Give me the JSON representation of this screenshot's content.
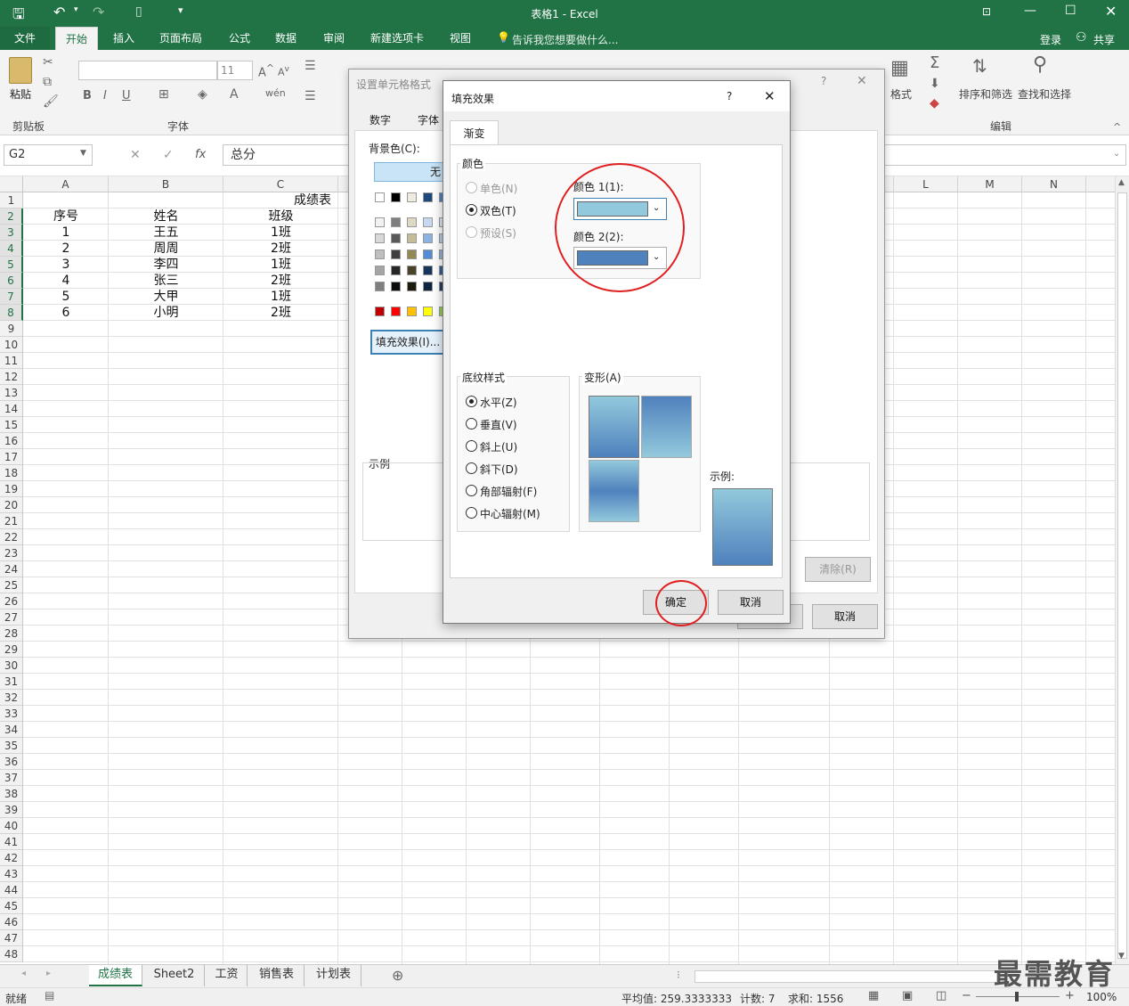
{
  "title_bar": {
    "doc_title": "表格1 - Excel"
  },
  "ribbon_tabs": [
    {
      "label": "文件"
    },
    {
      "label": "开始"
    },
    {
      "label": "插入"
    },
    {
      "label": "页面布局"
    },
    {
      "label": "公式"
    },
    {
      "label": "数据"
    },
    {
      "label": "审阅"
    },
    {
      "label": "新建选项卡"
    },
    {
      "label": "视图"
    }
  ],
  "tell_me": "告诉我您想要做什么...",
  "login": "登录",
  "share": "共享",
  "ribbon": {
    "paste": "粘贴",
    "clipboard_group": "剪贴板",
    "font_group": "字体",
    "font_size": "11",
    "format_label": "格式",
    "sort_filter": "排序和筛选",
    "find_select": "查找和选择",
    "edit_group": "编辑"
  },
  "formula_bar": {
    "cell_ref": "G2",
    "formula": "总分"
  },
  "columns": [
    "A",
    "B",
    "C",
    "L",
    "M",
    "N"
  ],
  "rows": [
    "1",
    "2",
    "3",
    "4",
    "5",
    "6",
    "7",
    "8",
    "9",
    "10",
    "11",
    "12",
    "13",
    "14",
    "15",
    "16",
    "17",
    "18",
    "19",
    "20",
    "21",
    "22",
    "23",
    "24",
    "25",
    "26",
    "27",
    "28",
    "29",
    "30",
    "31",
    "32",
    "33",
    "34",
    "35",
    "36",
    "37",
    "38",
    "39",
    "40",
    "41",
    "42",
    "43",
    "44",
    "45",
    "46",
    "47",
    "48"
  ],
  "sheet": {
    "title": "成绩表",
    "headers": [
      "序号",
      "姓名",
      "班级"
    ],
    "rows": [
      [
        "1",
        "王五",
        "1班"
      ],
      [
        "2",
        "周周",
        "2班"
      ],
      [
        "3",
        "李四",
        "1班"
      ],
      [
        "4",
        "张三",
        "2班"
      ],
      [
        "5",
        "大甲",
        "1班"
      ],
      [
        "6",
        "小明",
        "2班"
      ]
    ]
  },
  "format_dialog": {
    "title": "设置单元格格式",
    "tabs": [
      "数字",
      "字体"
    ],
    "bg_color_label": "背景色(C):",
    "no_color": "无",
    "fill_effects_btn": "填充效果(I)...",
    "sample_label": "示例",
    "clear_btn": "清除(R)",
    "cancel_btn": "取消",
    "help": "?"
  },
  "fill_dialog": {
    "title": "填充效果",
    "help": "?",
    "tab": "渐变",
    "colors_group": "颜色",
    "one_color": "单色(N)",
    "two_colors": "双色(T)",
    "preset": "预设(S)",
    "color1_label": "颜色 1(1):",
    "color2_label": "颜色 2(2):",
    "color1": "#93c9dc",
    "color2": "#4f81bd",
    "shading_group": "底纹样式",
    "styles": [
      "水平(Z)",
      "垂直(V)",
      "斜上(U)",
      "斜下(D)",
      "角部辐射(F)",
      "中心辐射(M)"
    ],
    "variants_group": "变形(A)",
    "sample_label": "示例:",
    "ok": "确定",
    "cancel": "取消"
  },
  "sheet_tabs": [
    {
      "label": "成绩表"
    },
    {
      "label": "Sheet2"
    },
    {
      "label": "工资"
    },
    {
      "label": "销售表"
    },
    {
      "label": "计划表"
    }
  ],
  "status": {
    "ready": "就绪",
    "average": "平均值: 259.3333333",
    "count": "计数: 7",
    "sum": "求和: 1556",
    "zoom": "100%"
  },
  "watermark": "最需教育"
}
